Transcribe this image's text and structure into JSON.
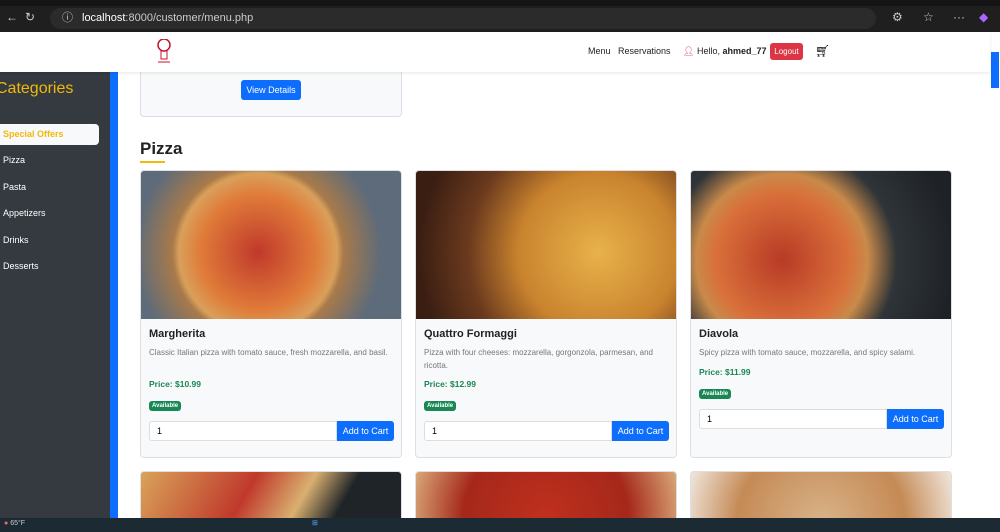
{
  "browser": {
    "url_host": "localhost",
    "url_rest": ":8000/customer/menu.php"
  },
  "navbar": {
    "menu": "Menu",
    "reservations": "Reservations",
    "hello": "Hello, ",
    "username": "ahmed_77",
    "logout": "Logout"
  },
  "sidebar": {
    "title": "Categories",
    "items": [
      {
        "label": "Special Offers"
      },
      {
        "label": "Pizza"
      },
      {
        "label": "Pasta"
      },
      {
        "label": "Appetizers"
      },
      {
        "label": "Drinks"
      },
      {
        "label": "Desserts"
      }
    ]
  },
  "top_card": {
    "button": "View Details"
  },
  "section": {
    "title": "Pizza"
  },
  "items": [
    {
      "name": "Margherita",
      "desc": "Classic Italian pizza with tomato sauce, fresh mozzarella, and basil.",
      "price": "Price: $10.99",
      "status": "Available",
      "qty": "1",
      "button": "Add to Cart"
    },
    {
      "name": "Quattro Formaggi",
      "desc": "Pizza with four cheeses: mozzarella, gorgonzola, parmesan, and ricotta.",
      "price": "Price: $12.99",
      "status": "Available",
      "qty": "1",
      "button": "Add to Cart"
    },
    {
      "name": "Diavola",
      "desc": "Spicy pizza with tomato sauce, mozzarella, and spicy salami.",
      "price": "Price: $11.99",
      "status": "Available",
      "qty": "1",
      "button": "Add to Cart"
    }
  ],
  "taskbar": {
    "weather": "65°F"
  }
}
